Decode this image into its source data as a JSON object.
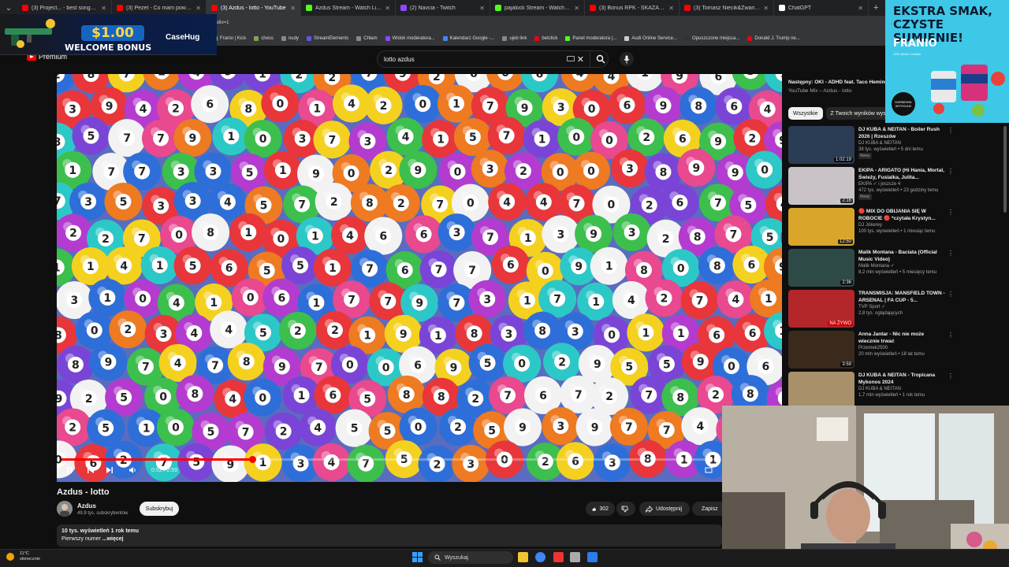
{
  "browser": {
    "tabs": [
      {
        "title": "(3) Project... - best songs - You",
        "color": "#ff0000"
      },
      {
        "title": "(3) Pezet - Co mam powiedzieć",
        "color": "#ff0000"
      },
      {
        "title": "(3) Azdus - lotto - YouTube",
        "color": "#ff0000",
        "active": true
      },
      {
        "title": "Azdus Stream - Watch Live on K",
        "color": "#53fc18"
      },
      {
        "title": "(2) Navcia - Twitch",
        "color": "#9146ff"
      },
      {
        "title": "pajalock Stream - Watch Live o",
        "color": "#53fc18"
      },
      {
        "title": "(3) Bonus RPK - SKAZANY NA T",
        "color": "#ff0000"
      },
      {
        "title": "(3) Tomasz Niecik&Zwariowany",
        "color": "#ff0000"
      },
      {
        "title": "ChatGPT",
        "color": "#ffffff"
      }
    ],
    "address_fragment": "art_radio=1",
    "bookmarks": [
      {
        "label": "Franio | Kick",
        "color": "#53fc18"
      },
      {
        "label": "chess",
        "color": "#7fa650"
      },
      {
        "label": "nudy",
        "color": "#888888"
      },
      {
        "label": "StreamElements",
        "color": "#5a5ae6"
      },
      {
        "label": "Chłam",
        "color": "#888888"
      },
      {
        "label": "Widok moderatora...",
        "color": "#9146ff"
      },
      {
        "label": "Kalendarz Google -...",
        "color": "#4285f4"
      },
      {
        "label": "ujeb link",
        "color": "#888888"
      },
      {
        "label": "betclick",
        "color": "#e30613"
      },
      {
        "label": "Panel moderatora |...",
        "color": "#53fc18"
      },
      {
        "label": "Audi Online Service...",
        "color": "#cccccc"
      },
      {
        "label": "Opuszczone miejsca...",
        "color": "#333333"
      },
      {
        "label": "Donald J. Trump ne...",
        "color": "#e30613"
      }
    ],
    "new_tab": "+"
  },
  "ad_banner": {
    "amount": "$1.00",
    "text": "WELCOME BONUS",
    "brand": "CaseHug"
  },
  "youtube": {
    "logo_text": "Premium",
    "search_value": "lotto azdus",
    "video": {
      "title": "Azdus - lotto",
      "time": "0:52 / 2:59",
      "progress": 0.29
    },
    "channel": {
      "name": "Azdus",
      "subscribers": "49,9 tys. subskrybentów",
      "subscribe_label": "Subskrybuj"
    },
    "actions": {
      "likes": "302",
      "share": "Udostępnij",
      "save": "Zapisz"
    },
    "description": {
      "stats": "10 tys. wyświetleń  1 rok temu",
      "text": "Pierwszy numer ",
      "more": "...więcej"
    },
    "next_up": {
      "label": "Następny: OKI - ADHD feat. Taco Hemingway",
      "sub": "YouTube Mix – Azdus - lotto"
    },
    "chips": [
      "Wszystkie",
      "Z Twoich wyników wyszukiwania"
    ],
    "recommendations": [
      {
        "title": "DJ KUBA & NEITAN - Boiler Rush 2026 | Rzeszów",
        "channel": "DJ KUBA & NEITAN",
        "meta": "38 tys. wyświetleń • 5 dni temu",
        "badge": "Nowy",
        "duration": "1:02:19",
        "thumb": "#2b3c55"
      },
      {
        "title": "EKIPA - ARIGATO (Hi Hania, Mortal, Świeży, Fusialka, Julita...",
        "channel": "EKIPA ✓ i jeszcze 4",
        "meta": "472 tys. wyświetleń • 23 godziny temu",
        "badge": "Nowy",
        "duration": "2:16",
        "thumb": "#c9c3c8"
      },
      {
        "title": "🔴 MIX DO OBIJANIA SIĘ W ROBOCIE 🔴 *czytała Krystyn...",
        "channel": "DJ Jokerey",
        "meta": "100 tys. wyświetleń • 1 miesiąc temu",
        "badge": "",
        "duration": "12:50",
        "thumb": "#d9a52a"
      },
      {
        "title": "Malik Montana - Baciata (Official Music Video)",
        "channel": "Malik Montana ✓",
        "meta": "8,2 mln wyświetleń • 5 miesięcy temu",
        "badge": "",
        "duration": "2:36",
        "thumb": "#2e4a47"
      },
      {
        "title": "TRANSMISJA: MANSFIELD TOWN - ARSENAL | FA CUP - 5...",
        "channel": "TVP Sport ✓",
        "meta": "2,8 tys. oglądających",
        "badge": "",
        "duration": "NA ŻYWO",
        "thumb": "#b3262a"
      },
      {
        "title": "Anna Jantar - Nic nie może wiecznie trwać",
        "channel": "Przemek2500",
        "meta": "20 mln wyświetleń • 18 lat temu",
        "badge": "",
        "duration": "3:59",
        "thumb": "#3a2a1c"
      },
      {
        "title": "DJ KUBA & NEITAN - Tropicana Mykonos 2024",
        "channel": "DJ KUBA & NEITAN",
        "meta": "1,7 mln wyświetleń • 1 rok temu",
        "badge": "",
        "duration": "",
        "thumb": "#a8906a"
      }
    ]
  },
  "franio_ad": {
    "headline_1": "EKSTRA SMAK,",
    "headline_2": "CZYSTE SUMIENIE!",
    "brand": "FRANIO",
    "sub": "10% zniżki z kodem",
    "badge": "DARMOWA WYSYŁKA!"
  },
  "taskbar": {
    "weather_temp": "11°C",
    "weather_desc": "słonecznie",
    "search_label": "Wyszukaj"
  },
  "colors": {
    "accent": "#ff0000",
    "background": "#0f0f0f"
  }
}
